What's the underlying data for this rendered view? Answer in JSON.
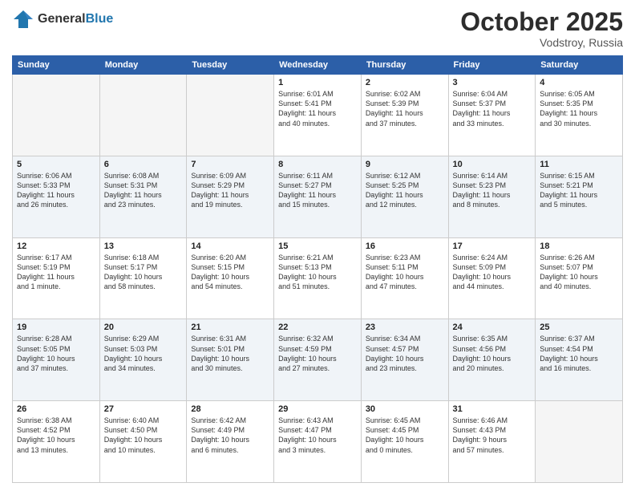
{
  "header": {
    "logo_line1": "General",
    "logo_line2": "Blue",
    "month": "October 2025",
    "location": "Vodstroy, Russia"
  },
  "weekdays": [
    "Sunday",
    "Monday",
    "Tuesday",
    "Wednesday",
    "Thursday",
    "Friday",
    "Saturday"
  ],
  "weeks": [
    [
      {
        "day": "",
        "info": ""
      },
      {
        "day": "",
        "info": ""
      },
      {
        "day": "",
        "info": ""
      },
      {
        "day": "1",
        "info": "Sunrise: 6:01 AM\nSunset: 5:41 PM\nDaylight: 11 hours\nand 40 minutes."
      },
      {
        "day": "2",
        "info": "Sunrise: 6:02 AM\nSunset: 5:39 PM\nDaylight: 11 hours\nand 37 minutes."
      },
      {
        "day": "3",
        "info": "Sunrise: 6:04 AM\nSunset: 5:37 PM\nDaylight: 11 hours\nand 33 minutes."
      },
      {
        "day": "4",
        "info": "Sunrise: 6:05 AM\nSunset: 5:35 PM\nDaylight: 11 hours\nand 30 minutes."
      }
    ],
    [
      {
        "day": "5",
        "info": "Sunrise: 6:06 AM\nSunset: 5:33 PM\nDaylight: 11 hours\nand 26 minutes."
      },
      {
        "day": "6",
        "info": "Sunrise: 6:08 AM\nSunset: 5:31 PM\nDaylight: 11 hours\nand 23 minutes."
      },
      {
        "day": "7",
        "info": "Sunrise: 6:09 AM\nSunset: 5:29 PM\nDaylight: 11 hours\nand 19 minutes."
      },
      {
        "day": "8",
        "info": "Sunrise: 6:11 AM\nSunset: 5:27 PM\nDaylight: 11 hours\nand 15 minutes."
      },
      {
        "day": "9",
        "info": "Sunrise: 6:12 AM\nSunset: 5:25 PM\nDaylight: 11 hours\nand 12 minutes."
      },
      {
        "day": "10",
        "info": "Sunrise: 6:14 AM\nSunset: 5:23 PM\nDaylight: 11 hours\nand 8 minutes."
      },
      {
        "day": "11",
        "info": "Sunrise: 6:15 AM\nSunset: 5:21 PM\nDaylight: 11 hours\nand 5 minutes."
      }
    ],
    [
      {
        "day": "12",
        "info": "Sunrise: 6:17 AM\nSunset: 5:19 PM\nDaylight: 11 hours\nand 1 minute."
      },
      {
        "day": "13",
        "info": "Sunrise: 6:18 AM\nSunset: 5:17 PM\nDaylight: 10 hours\nand 58 minutes."
      },
      {
        "day": "14",
        "info": "Sunrise: 6:20 AM\nSunset: 5:15 PM\nDaylight: 10 hours\nand 54 minutes."
      },
      {
        "day": "15",
        "info": "Sunrise: 6:21 AM\nSunset: 5:13 PM\nDaylight: 10 hours\nand 51 minutes."
      },
      {
        "day": "16",
        "info": "Sunrise: 6:23 AM\nSunset: 5:11 PM\nDaylight: 10 hours\nand 47 minutes."
      },
      {
        "day": "17",
        "info": "Sunrise: 6:24 AM\nSunset: 5:09 PM\nDaylight: 10 hours\nand 44 minutes."
      },
      {
        "day": "18",
        "info": "Sunrise: 6:26 AM\nSunset: 5:07 PM\nDaylight: 10 hours\nand 40 minutes."
      }
    ],
    [
      {
        "day": "19",
        "info": "Sunrise: 6:28 AM\nSunset: 5:05 PM\nDaylight: 10 hours\nand 37 minutes."
      },
      {
        "day": "20",
        "info": "Sunrise: 6:29 AM\nSunset: 5:03 PM\nDaylight: 10 hours\nand 34 minutes."
      },
      {
        "day": "21",
        "info": "Sunrise: 6:31 AM\nSunset: 5:01 PM\nDaylight: 10 hours\nand 30 minutes."
      },
      {
        "day": "22",
        "info": "Sunrise: 6:32 AM\nSunset: 4:59 PM\nDaylight: 10 hours\nand 27 minutes."
      },
      {
        "day": "23",
        "info": "Sunrise: 6:34 AM\nSunset: 4:57 PM\nDaylight: 10 hours\nand 23 minutes."
      },
      {
        "day": "24",
        "info": "Sunrise: 6:35 AM\nSunset: 4:56 PM\nDaylight: 10 hours\nand 20 minutes."
      },
      {
        "day": "25",
        "info": "Sunrise: 6:37 AM\nSunset: 4:54 PM\nDaylight: 10 hours\nand 16 minutes."
      }
    ],
    [
      {
        "day": "26",
        "info": "Sunrise: 6:38 AM\nSunset: 4:52 PM\nDaylight: 10 hours\nand 13 minutes."
      },
      {
        "day": "27",
        "info": "Sunrise: 6:40 AM\nSunset: 4:50 PM\nDaylight: 10 hours\nand 10 minutes."
      },
      {
        "day": "28",
        "info": "Sunrise: 6:42 AM\nSunset: 4:49 PM\nDaylight: 10 hours\nand 6 minutes."
      },
      {
        "day": "29",
        "info": "Sunrise: 6:43 AM\nSunset: 4:47 PM\nDaylight: 10 hours\nand 3 minutes."
      },
      {
        "day": "30",
        "info": "Sunrise: 6:45 AM\nSunset: 4:45 PM\nDaylight: 10 hours\nand 0 minutes."
      },
      {
        "day": "31",
        "info": "Sunrise: 6:46 AM\nSunset: 4:43 PM\nDaylight: 9 hours\nand 57 minutes."
      },
      {
        "day": "",
        "info": ""
      }
    ]
  ]
}
